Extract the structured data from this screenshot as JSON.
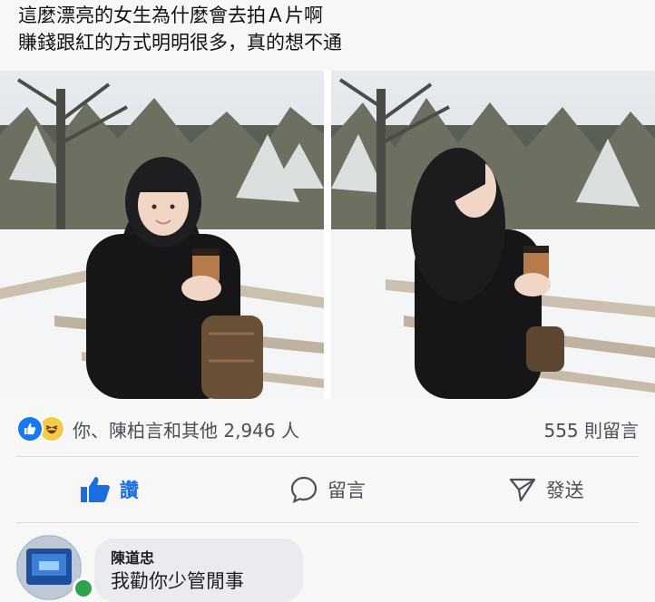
{
  "post": {
    "text_line1": "這麼漂亮的女生為什麼會去拍Ａ片啊",
    "text_line2": "賺錢跟紅的方式明明很多，真的想不通"
  },
  "photos": [
    {
      "icon": "photo-woman-smiling"
    },
    {
      "icon": "photo-woman-profile"
    }
  ],
  "reactions": {
    "summary": "你、陳柏言和其他 2,946 人",
    "comment_count": "555 則留言",
    "icons": [
      "like-icon",
      "haha-icon"
    ],
    "colors": {
      "like": "#1877f2",
      "haha": "#f7c948"
    }
  },
  "actions": {
    "like_label": "讚",
    "comment_label": "留言",
    "share_label": "發送"
  },
  "comment": {
    "author": "陳道忠",
    "text": "我勸你少管閒事"
  },
  "colors": {
    "accent": "#1a6fe0",
    "presence": "#31a24c"
  }
}
